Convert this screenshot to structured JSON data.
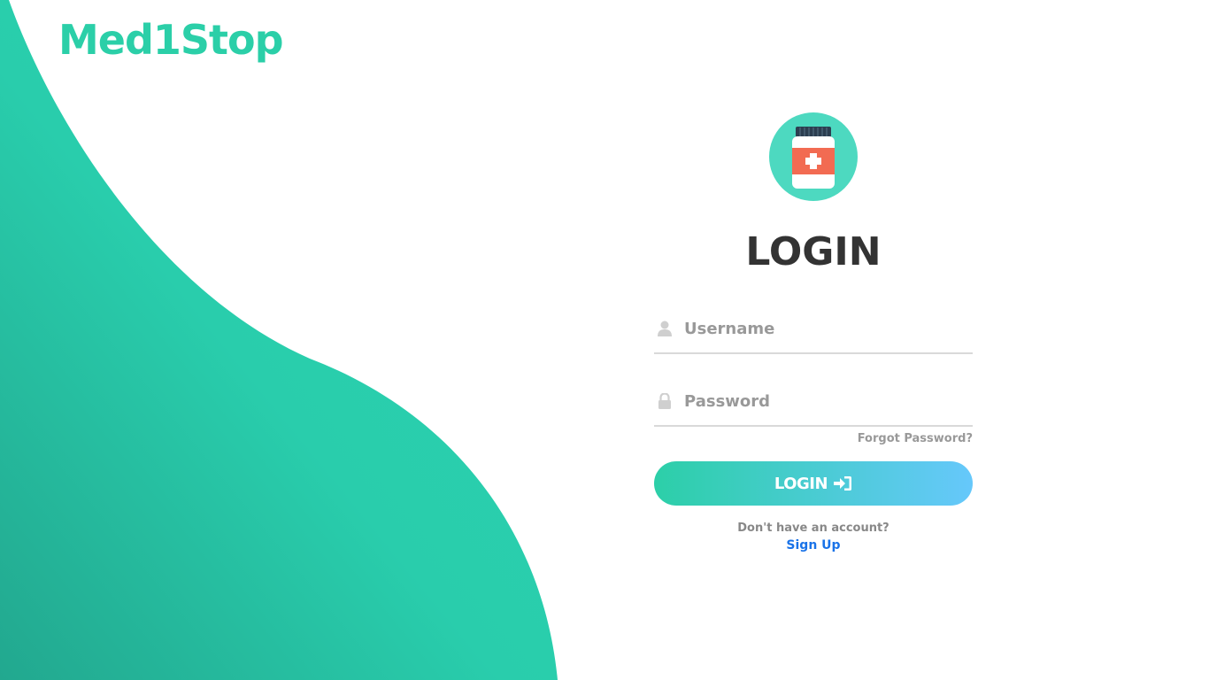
{
  "brand": {
    "name": "Med1Stop",
    "color": "#2bcfa8"
  },
  "theme": {
    "wave_light": "#2bd4b0",
    "wave_dark": "#22a88f",
    "avatar_bg": "#4dd9c0",
    "bottle_cap": "#2c3e50",
    "bottle_label": "#f26b52",
    "button_start": "#2ccfa8",
    "button_end": "#66c8fb",
    "link_color": "#1a73e8"
  },
  "login": {
    "avatar_icon": "medicine-bottle-icon",
    "heading": "LOGIN",
    "username_placeholder": "Username",
    "username_icon": "user-icon",
    "password_placeholder": "Password",
    "password_icon": "lock-icon",
    "forgot_label": "Forgot Password?",
    "submit_label": "LOGIN",
    "submit_icon": "sign-in-icon",
    "no_account_text": "Don't have an account?",
    "signup_label": "Sign Up"
  }
}
